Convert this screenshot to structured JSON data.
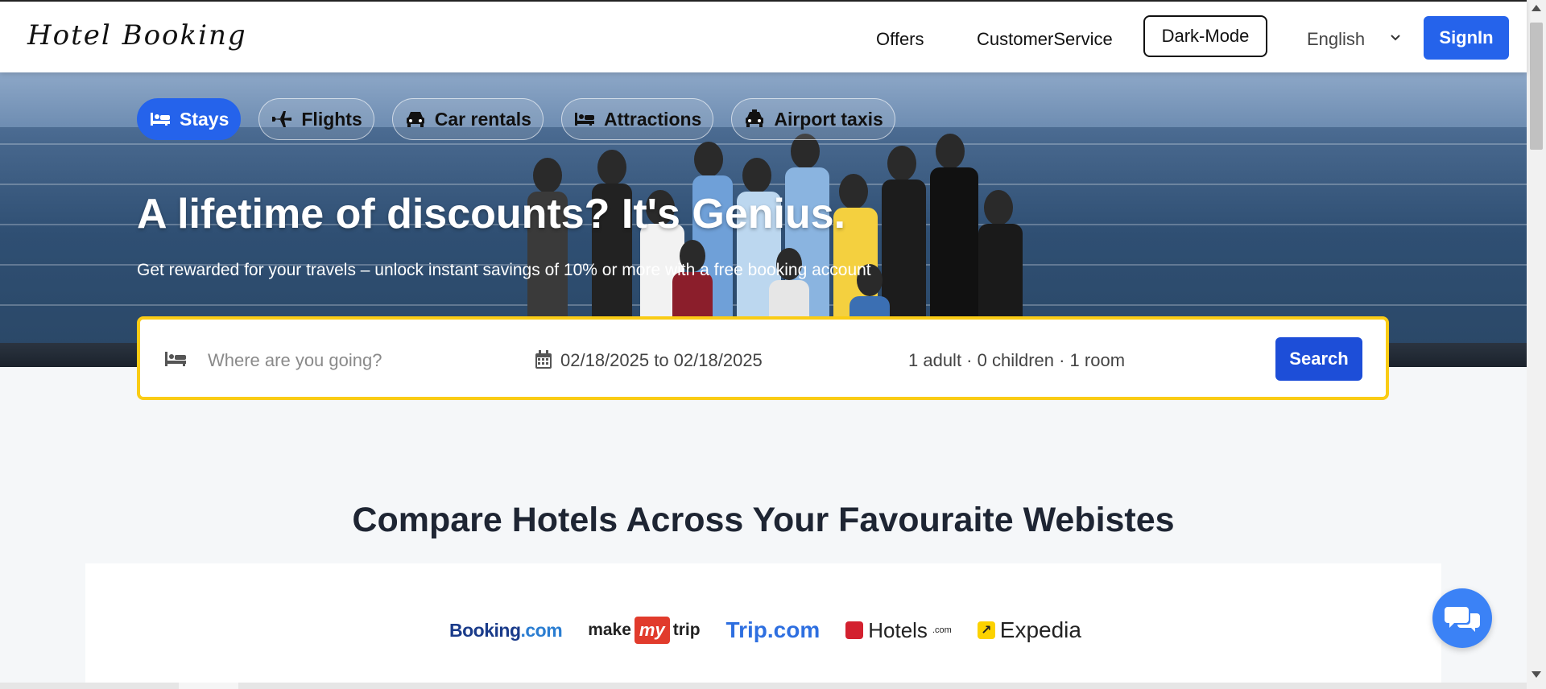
{
  "header": {
    "logo": "Hotel Booking",
    "nav": [
      "Offers",
      "CustomerService"
    ],
    "dark_mode_label": "Dark-Mode",
    "language": "English",
    "signin_label": "SignIn"
  },
  "hero": {
    "tabs": [
      {
        "label": "Stays",
        "icon": "bed-icon",
        "active": true
      },
      {
        "label": "Flights",
        "icon": "plane-icon",
        "active": false
      },
      {
        "label": "Car rentals",
        "icon": "car-icon",
        "active": false
      },
      {
        "label": "Attractions",
        "icon": "bed-icon",
        "active": false
      },
      {
        "label": "Airport taxis",
        "icon": "taxi-icon",
        "active": false
      }
    ],
    "headline": "A lifetime of discounts? It's Genius.",
    "subline": "Get rewarded for your travels – unlock instant savings of 10% or more with a free booking account"
  },
  "search": {
    "destination_placeholder": "Where are you going?",
    "dates": "02/18/2025 to 02/18/2025",
    "guests": "1 adult · 0 children · 1 room",
    "button_label": "Search"
  },
  "compare": {
    "title": "Compare Hotels Across Your Favouraite Webistes",
    "partners": {
      "booking": [
        "Booking",
        ".com"
      ],
      "makemytrip": [
        "make",
        "my",
        "trip"
      ],
      "trip": "Trip.com",
      "hotels": [
        "Hotels",
        ".com"
      ],
      "expedia": "Expedia"
    }
  },
  "colors": {
    "accent": "#2563eb",
    "search_border": "#facc15",
    "chat": "#3b82f6"
  }
}
